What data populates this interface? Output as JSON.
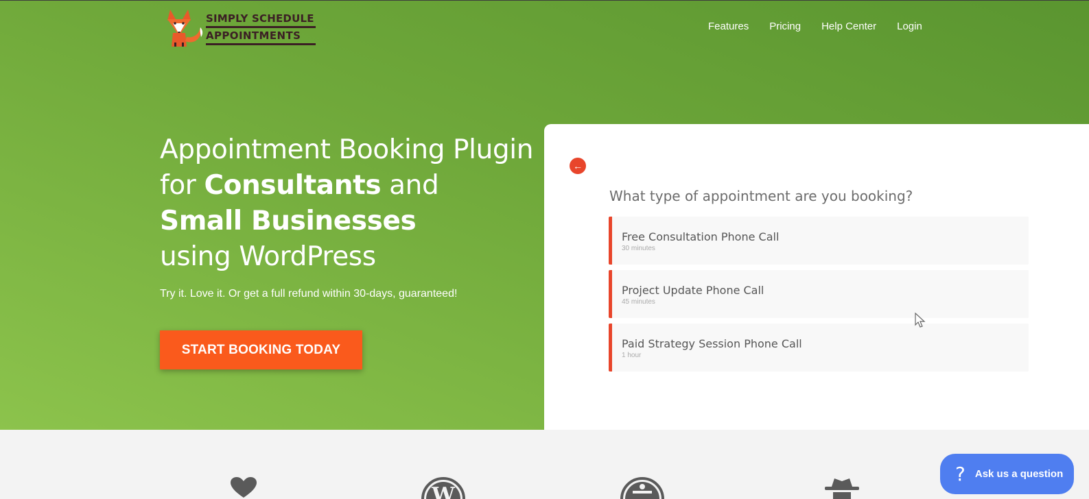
{
  "brand": {
    "line1": "SIMPLY SCHEDULE",
    "line2": "APPOINTMENTS",
    "logo_icon": "fox-icon"
  },
  "nav": {
    "items": [
      "Features",
      "Pricing",
      "Help Center",
      "Login"
    ]
  },
  "hero": {
    "line1": "Appointment Booking Plugin",
    "line2_pre": "for ",
    "line2_bold": "Consultants",
    "line2_post": " and",
    "line3_bold": "Small Businesses",
    "line4": "using WordPress",
    "subtext": "Try it. Love it. Or get a full refund within 30-days, guaranteed!",
    "cta_label": "START BOOKING TODAY"
  },
  "booking": {
    "back_icon": "arrow-left-icon",
    "question": "What type of appointment are you booking?",
    "options": [
      {
        "title": "Free Consultation Phone Call",
        "duration": "30 minutes"
      },
      {
        "title": "Project Update Phone Call",
        "duration": "45 minutes"
      },
      {
        "title": "Paid Strategy Session Phone Call",
        "duration": "1 hour"
      }
    ]
  },
  "features": {
    "icons": [
      "heart-icon",
      "wordpress-icon",
      "accessibility-icon",
      "spy-icon"
    ]
  },
  "help": {
    "label": "Ask us a question",
    "icon": "question-icon"
  },
  "colors": {
    "accent": "#fa5a1c",
    "hero_green": "#6fa83a",
    "appt_border": "#e8452b",
    "help_blue": "#4f7ef0"
  }
}
